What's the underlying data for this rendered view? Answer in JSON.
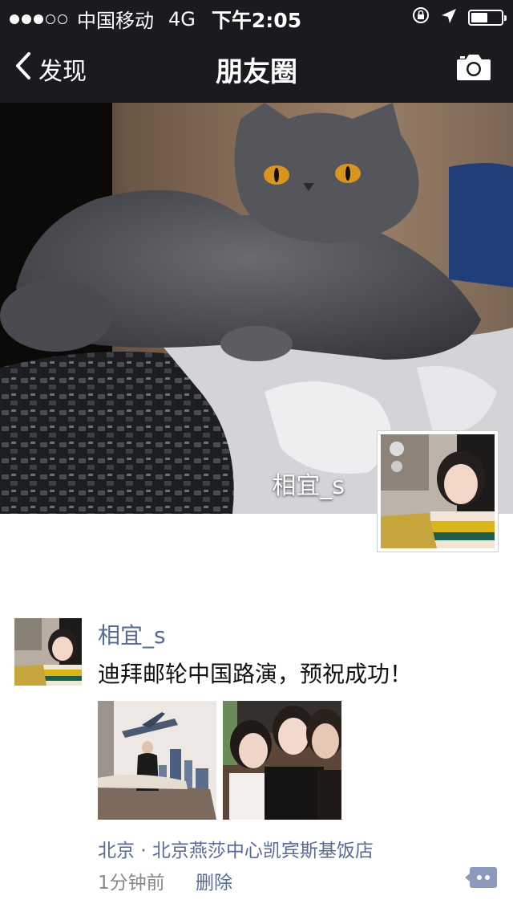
{
  "status_bar": {
    "carrier": "中国移动",
    "network": "4G",
    "time": "下午2:05",
    "signal_bars": 3,
    "battery_level": 0.55
  },
  "nav": {
    "back_label": "发现",
    "title": "朋友圈"
  },
  "cover": {
    "user_name": "相宜_s"
  },
  "post": {
    "author": "相宜_s",
    "text": "迪拜邮轮中国路演，预祝成功！",
    "location": "北京 · 北京燕莎中心凯宾斯基饭店",
    "time": "1分钟前",
    "delete_label": "删除"
  },
  "colors": {
    "nav_bg": "#1b1b1f",
    "link": "#576b95"
  },
  "icons": [
    "chevron-left-icon",
    "camera-icon",
    "lock-rotation-icon",
    "location-arrow-icon",
    "battery-icon",
    "comment-icon"
  ]
}
